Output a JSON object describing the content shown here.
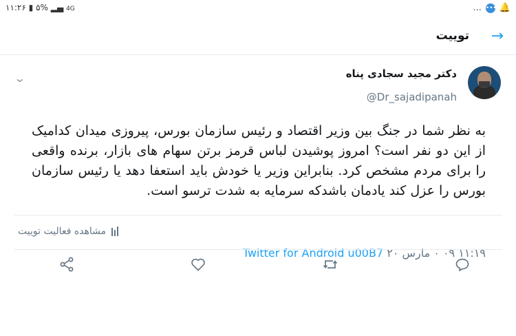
{
  "status_bar": {
    "time": "۱۱:۲۶",
    "battery": "۵%",
    "network": "4G",
    "more": "..."
  },
  "header": {
    "title": "توییت"
  },
  "tweet": {
    "author_name": "دکتر مجید سجادی پناه",
    "author_handle": "@Dr_sajadipanah",
    "text": "به نظر شما در جنگ بین وزیر اقتصاد و رئیس سازمان بورس، پیروزی میدان کدامیک از این دو نفر است؟ امروز پوشیدن لباس قرمز برتن سهام های بازار، برنده واقعی را برای مردم مشخص کرد. بنابراین وزیر یا خودش باید استعفا دهد یا رئیس سازمان بورس را عزل کند یادمان باشدکه سرمایه به شدت ترسو است.",
    "timestamp": "۱۱:۱۹ ۰۹ ۰ مارس ۲۰",
    "source": "Twitter for Android u00B7"
  },
  "activity": {
    "label": "مشاهده فعالیت توییت"
  },
  "colors": {
    "accent": "#1da1f2",
    "secondary_text": "#657786",
    "divider": "#e6ecf0"
  },
  "icons": [
    "back-arrow-icon",
    "caret-down-icon",
    "share-icon",
    "like-icon",
    "retweet-icon",
    "reply-icon",
    "activity-icon",
    "messenger-icon"
  ]
}
